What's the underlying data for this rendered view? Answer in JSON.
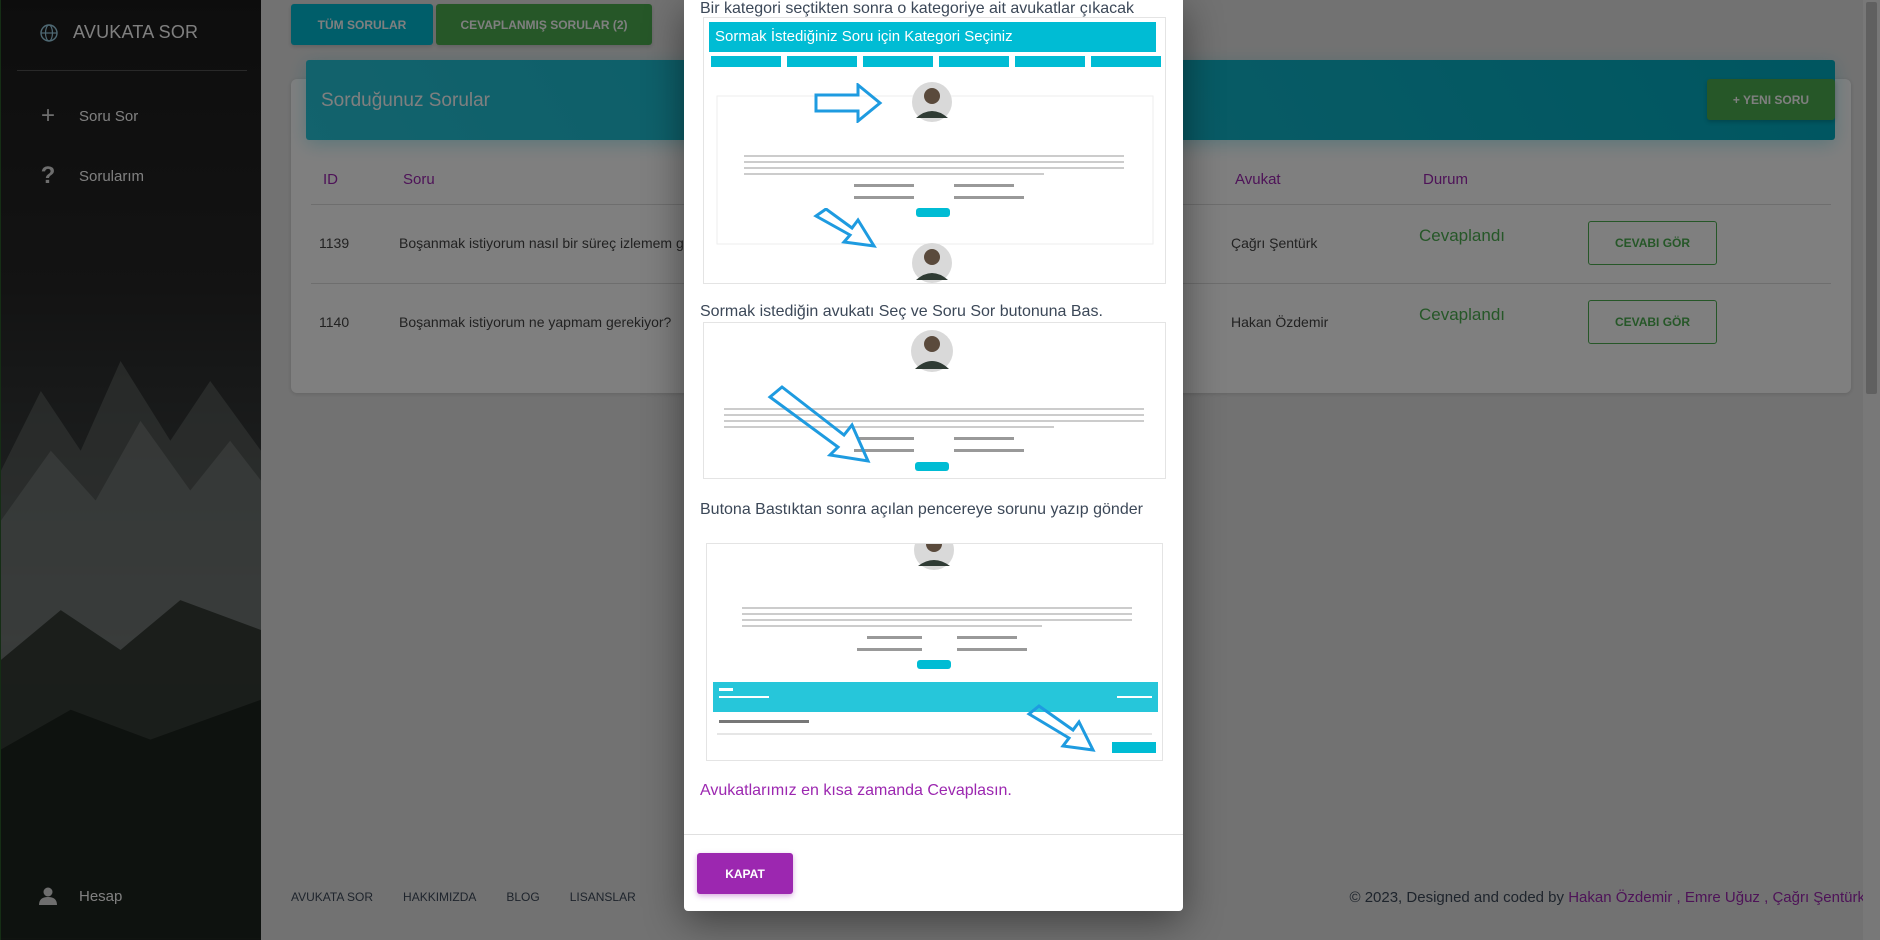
{
  "sidebar": {
    "brand": "AVUKATA SOR",
    "items": [
      {
        "label": "Soru Sor",
        "icon": "plus-icon"
      },
      {
        "label": "Sorularım",
        "icon": "question-icon"
      }
    ],
    "account": {
      "label": "Hesap",
      "icon": "user-icon"
    }
  },
  "tabs": [
    {
      "label": "TÜM SORULAR"
    },
    {
      "label": "CEVAPLANMIŞ SORULAR (2)"
    }
  ],
  "card": {
    "title": "Sorduğunuz Sorular",
    "new_button": "+ YENI SORU",
    "columns": {
      "id": "ID",
      "question": "Soru",
      "lawyer": "Avukat",
      "status": "Durum"
    },
    "rows": [
      {
        "id": "1139",
        "question": "Boşanmak istiyorum nasıl bir süreç izlemem ge",
        "lawyer": "Çağrı Şentürk",
        "status": "Cevaplandı",
        "action": "CEVABI GÖR"
      },
      {
        "id": "1140",
        "question": "Boşanmak istiyorum ne yapmam gerekiyor?",
        "lawyer": "Hakan Özdemir",
        "status": "Cevaplandı",
        "action": "CEVABI GÖR"
      }
    ]
  },
  "footer": {
    "links": [
      "AVUKATA SOR",
      "HAKKIMIZDA",
      "BLOG",
      "LISANSLAR"
    ],
    "copyright_prefix": "© 2023, Designed and coded by ",
    "authors": [
      "Hakan Özdemir",
      "Emre Uğuz",
      "Çağrı Şentürk"
    ],
    "separator": " , "
  },
  "modal": {
    "step1": "Bir kategori seçtikten sonra o kategoriye ait avukatlar çıkacak",
    "step1_image_heading": "Sormak İstediğiniz Soru için Kategori Seçiniz",
    "step2": "Sormak istediğin avukatı Seç ve Soru Sor butonuna Bas.",
    "step3": "Butona Bastıktan sonra açılan pencereye sorunu yazıp gönder",
    "closing": "Avukatlarımız en kısa zamanda Cevaplasın.",
    "close_button": "KAPAT"
  },
  "colors": {
    "accent_cyan": "#00bcd4",
    "accent_green": "#4caf50",
    "accent_purple": "#9c27b0",
    "arrow_blue": "#1e9be0"
  }
}
